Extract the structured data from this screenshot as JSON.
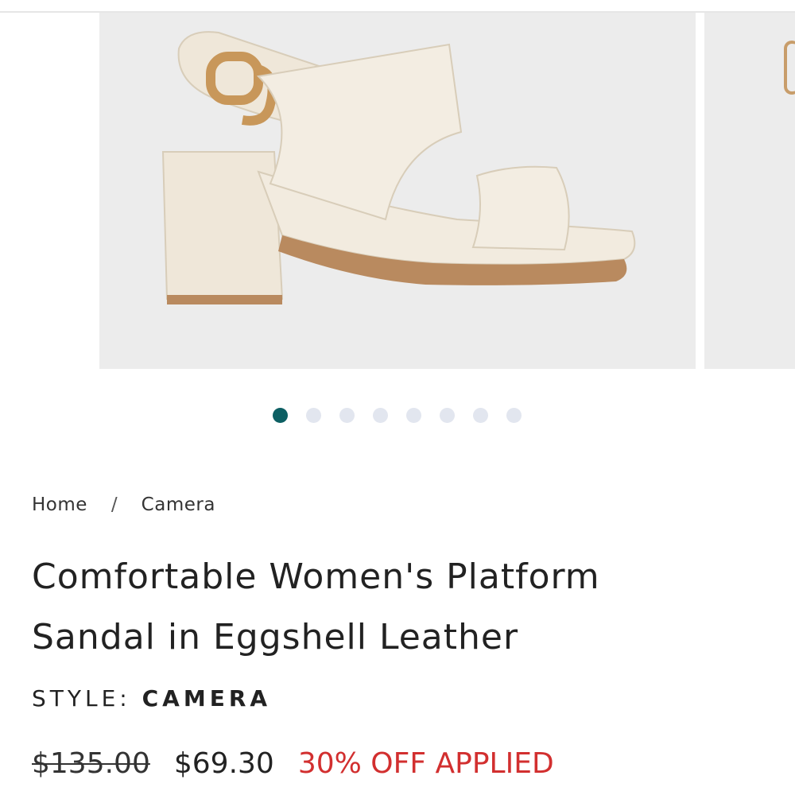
{
  "product_image": {
    "alt": "Comfortable Women's Platform Sandal in Eggshell Leather",
    "zoom_icon": "magnifier-icon",
    "slide_count": 8,
    "active_slide": 1
  },
  "breadcrumb": {
    "home": "Home",
    "separator": "/",
    "current": "Camera"
  },
  "product": {
    "title_line1": "Comfortable Women's Platform",
    "title_line2": "Sandal in Eggshell Leather",
    "style_label": "STYLE:",
    "style_value": "CAMERA"
  },
  "pricing": {
    "original": "$135.00",
    "sale": "$69.30",
    "discount_text": "30% OFF APPLIED"
  },
  "colors": {
    "accent_dot": "#0d5f63",
    "sale_red": "#d22f2f",
    "image_bg": "#ececec"
  }
}
